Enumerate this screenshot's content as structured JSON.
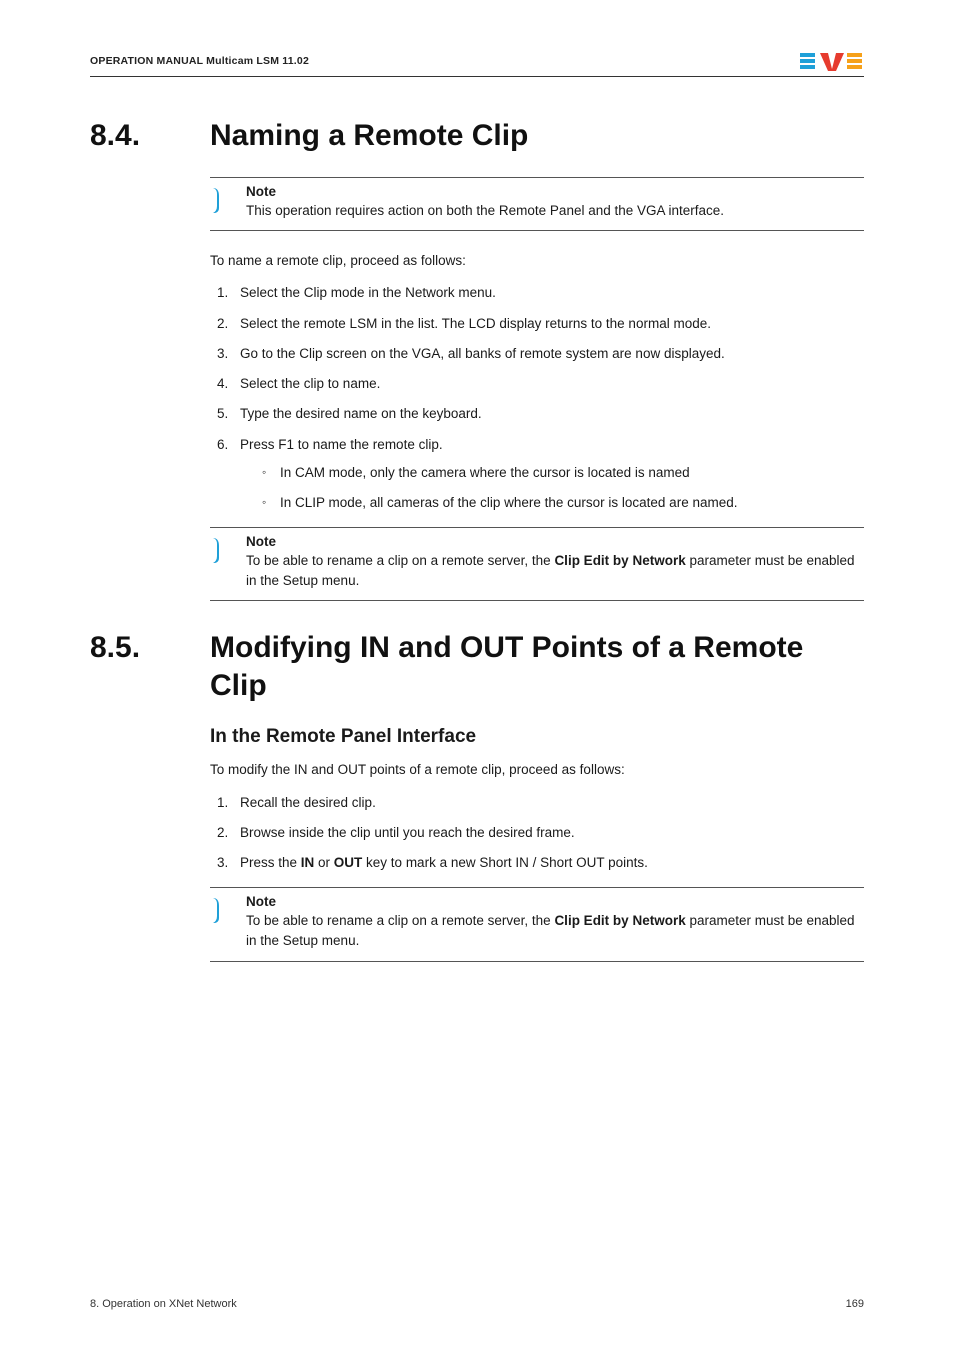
{
  "header": {
    "manual_title": "OPERATION MANUAL Multicam LSM 11.02"
  },
  "section84": {
    "num": "8.4.",
    "title": "Naming a Remote Clip",
    "note1_label": "Note",
    "note1_text": "This operation requires action on both the Remote Panel and the VGA interface.",
    "intro": "To name a remote clip, proceed as follows:",
    "steps": {
      "s1": "Select the Clip mode in the Network menu.",
      "s2": "Select the remote LSM in the list. The LCD display returns to the normal mode.",
      "s3": "Go to the Clip screen on the VGA, all banks of remote system are now displayed.",
      "s4": "Select the clip to name.",
      "s5": "Type the desired name on the keyboard.",
      "s6": "Press F1 to name the remote clip.",
      "s6a": "In CAM mode, only the camera where the cursor is located is named",
      "s6b": "In CLIP mode, all cameras of the clip where the cursor is located are named."
    },
    "note2_label": "Note",
    "note2_pre": "To be able to rename a clip on a remote server, the ",
    "note2_bold": "Clip Edit by Network",
    "note2_post": " parameter must be enabled in the Setup menu."
  },
  "section85": {
    "num": "8.5.",
    "title": "Modifying IN and OUT Points of a Remote Clip",
    "subheading": "In the Remote Panel Interface",
    "intro": "To modify the IN and OUT points of a remote clip, proceed as follows:",
    "steps": {
      "s1": "Recall the desired clip.",
      "s2": "Browse inside the clip until you reach the desired frame.",
      "s3_pre": "Press the ",
      "s3_b1": "IN",
      "s3_mid": " or ",
      "s3_b2": "OUT",
      "s3_post": " key to mark a new Short IN / Short OUT points."
    },
    "note_label": "Note",
    "note_pre": "To be able to rename a clip on a remote server, the ",
    "note_bold": "Clip Edit by Network",
    "note_post": " parameter must be enabled in the Setup menu."
  },
  "footer": {
    "left": "8. Operation on XNet Network",
    "right": "169"
  }
}
